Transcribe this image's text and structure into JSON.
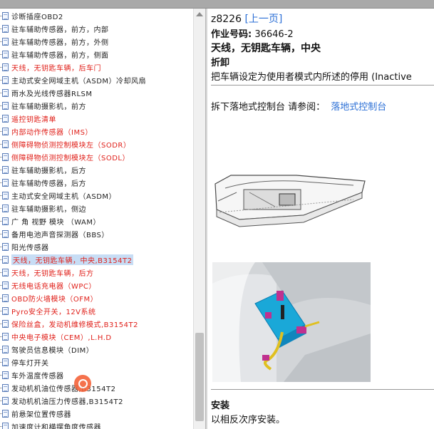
{
  "tree": {
    "items": [
      {
        "label": "诊断插座OBD2",
        "style": "normal"
      },
      {
        "label": "驻车辅助传感器，前方，内部",
        "style": "normal"
      },
      {
        "label": "驻车辅助传感器，前方，外侧",
        "style": "normal"
      },
      {
        "label": "驻车辅助传感器，前方，侧面",
        "style": "normal"
      },
      {
        "label": "天线，无钥匙车辆，后车门",
        "style": "red"
      },
      {
        "label": "主动式安全网域主机（ASDM）冷却风扇",
        "style": "normal"
      },
      {
        "label": "雨水及光线传感器RLSM",
        "style": "normal"
      },
      {
        "label": "驻车辅助摄影机，前方",
        "style": "normal"
      },
      {
        "label": "遥控钥匙清单",
        "style": "red"
      },
      {
        "label": "内部动作传感器（IMS）",
        "style": "red"
      },
      {
        "label": "侧障碍物侦测控制模块左（SODR）",
        "style": "red"
      },
      {
        "label": "侧障碍物侦测控制模块左（SODL）",
        "style": "red"
      },
      {
        "label": "驻车辅助摄影机，后方",
        "style": "normal"
      },
      {
        "label": "驻车辅助传感器，后方",
        "style": "normal"
      },
      {
        "label": "主动式安全网域主机（ASDM）",
        "style": "normal"
      },
      {
        "label": "驻车辅助摄影机，侧边",
        "style": "normal"
      },
      {
        "label": "广 角 视野 模块 （WAM）",
        "style": "normal"
      },
      {
        "label": "备用电池声音探测器（BBS）",
        "style": "normal"
      },
      {
        "label": "阳光传感器",
        "style": "normal"
      },
      {
        "label": "天线，无钥匙车辆，中央,B3154T2",
        "style": "selected"
      },
      {
        "label": "天线，无钥匙车辆，后方",
        "style": "red"
      },
      {
        "label": "无线电话充电器（WPC）",
        "style": "red"
      },
      {
        "label": "OBD防火墙模块（OFM）",
        "style": "red"
      },
      {
        "label": "Pyro安全开关，12V系统",
        "style": "red"
      },
      {
        "label": "保险丝盒，发动机维修模式,B3154T2",
        "style": "red"
      },
      {
        "label": "中央电子模块（CEM）,L.H.D",
        "style": "red"
      },
      {
        "label": "驾驶员信息模块（DIM）",
        "style": "normal"
      },
      {
        "label": "停车灯开关",
        "style": "normal"
      },
      {
        "label": "车外温度传感器",
        "style": "normal"
      },
      {
        "label": "发动机机油位传感器,B3154T2",
        "style": "normal"
      },
      {
        "label": "发动机机油压力传感器,B3154T2",
        "style": "normal"
      },
      {
        "label": "前悬架位置传感器",
        "style": "normal"
      },
      {
        "label": "加速度计和横摆角度传感器",
        "style": "normal"
      }
    ]
  },
  "doc": {
    "code": "z8226",
    "prev_link": "[上一页]",
    "op_no_label": "作业号码:",
    "op_no_value": "36646-2",
    "title": "天线，无钥匙车辆，中央",
    "section_remove": "折卸",
    "instruction": "把车辆设定为使用者模式内所述的停用 (Inactive",
    "step_text": "拆下落地式控制台 请参阅：",
    "step_link": "落地式控制台",
    "section_install": "安装",
    "install_text": "以相反次序安装。"
  },
  "colors": {
    "link": "#2b6fd6",
    "red_item": "#e0201a",
    "selection": "#c7ddf5",
    "module_cyan": "#1aa8d8",
    "connector_magenta": "#c0318f"
  },
  "icons": {
    "tree_item": "document-icon",
    "overlay": "search-badge-icon"
  }
}
